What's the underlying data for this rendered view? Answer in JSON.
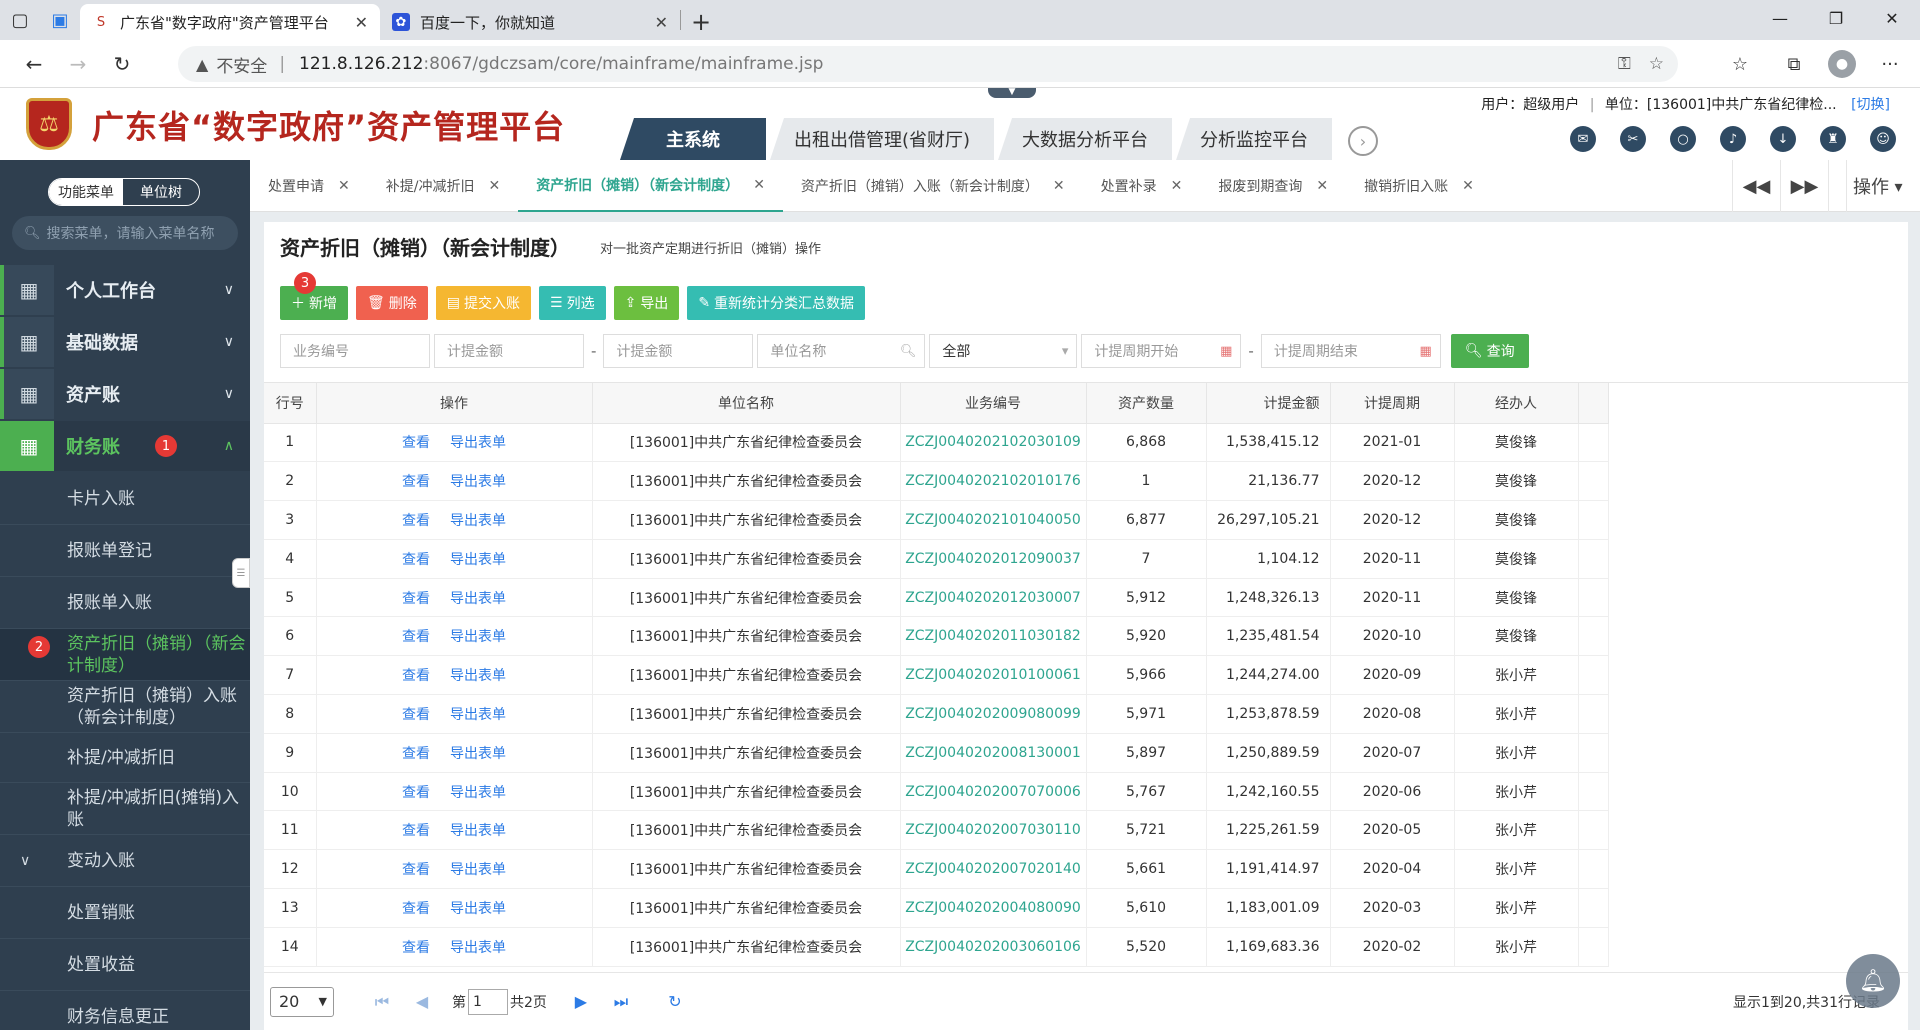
{
  "browser": {
    "tabs": [
      {
        "title": "广东省\"数字政府\"资产管理平台",
        "active": true
      },
      {
        "title": "百度一下，你就知道",
        "active": false
      }
    ],
    "address": {
      "security_label": "不安全",
      "host": "121.8.126.212",
      "path": ":8067/gdczsam/core/mainframe/mainframe.jsp"
    }
  },
  "header": {
    "title": "广东省“数字政府”资产管理平台",
    "user_label": "用户：超级用户",
    "unit_label": "单位：[136001]中共广东省纪律检...",
    "switch_label": "[切换]",
    "system_tabs": [
      "主系统",
      "出租出借管理(省财厅)",
      "大数据分析平台",
      "分析监控平台"
    ]
  },
  "sidebar": {
    "switch": [
      "功能菜单",
      "单位树"
    ],
    "search_placeholder": "搜索菜单，请输入菜单名称",
    "top_menus": [
      "个人工作台",
      "基础数据",
      "资产账",
      "财务账"
    ],
    "sub_items": [
      "卡片入账",
      "报账单登记",
      "报账单入账",
      "资产折旧（摊销）（新会计制度）",
      "资产折旧（摊销）入账（新会计制度）",
      "补提/冲减折旧",
      "补提/冲减折旧(摊销)入账",
      "变动入账",
      "处置销账",
      "处置收益",
      "财务信息更正"
    ],
    "badges": [
      "1",
      "2"
    ]
  },
  "content_tabs": [
    "处置申请",
    "补提/冲减折旧",
    "资产折旧（摊销）（新会计制度）",
    "资产折旧（摊销）入账（新会计制度）",
    "处置补录",
    "报废到期查询",
    "撤销折旧入账"
  ],
  "content_tabs_ops": "操作",
  "page": {
    "title": "资产折旧（摊销）（新会计制度）",
    "description": "对一批资产定期进行折旧（摊销）操作",
    "badge": "3",
    "toolbar": [
      "新增",
      "删除",
      "提交入账",
      "列选",
      "导出",
      "重新统计分类汇总数据"
    ],
    "filters": {
      "biz_no": "业务编号",
      "amount_from": "计提金额",
      "amount_to": "计提金额",
      "unit_name": "单位名称",
      "status_value": "全部",
      "period_start": "计提周期开始",
      "period_end": "计提周期结束",
      "query": "查询"
    }
  },
  "table": {
    "columns": [
      "行号",
      "操作",
      "单位名称",
      "业务编号",
      "资产数量",
      "计提金额",
      "计提周期",
      "经办人"
    ],
    "actions": [
      "查看",
      "导出表单"
    ],
    "rows": [
      [
        "1",
        "[136001]中共广东省纪律检查委员会",
        "ZCZJ0040202102030109",
        "6,868",
        "1,538,415.12",
        "2021-01",
        "莫俊锋"
      ],
      [
        "2",
        "[136001]中共广东省纪律检查委员会",
        "ZCZJ0040202102010176",
        "1",
        "21,136.77",
        "2020-12",
        "莫俊锋"
      ],
      [
        "3",
        "[136001]中共广东省纪律检查委员会",
        "ZCZJ0040202101040050",
        "6,877",
        "26,297,105.21",
        "2020-12",
        "莫俊锋"
      ],
      [
        "4",
        "[136001]中共广东省纪律检查委员会",
        "ZCZJ0040202012090037",
        "7",
        "1,104.12",
        "2020-11",
        "莫俊锋"
      ],
      [
        "5",
        "[136001]中共广东省纪律检查委员会",
        "ZCZJ0040202012030007",
        "5,912",
        "1,248,326.13",
        "2020-11",
        "莫俊锋"
      ],
      [
        "6",
        "[136001]中共广东省纪律检查委员会",
        "ZCZJ0040202011030182",
        "5,920",
        "1,235,481.54",
        "2020-10",
        "莫俊锋"
      ],
      [
        "7",
        "[136001]中共广东省纪律检查委员会",
        "ZCZJ0040202010100061",
        "5,966",
        "1,244,274.00",
        "2020-09",
        "张小芹"
      ],
      [
        "8",
        "[136001]中共广东省纪律检查委员会",
        "ZCZJ0040202009080099",
        "5,971",
        "1,253,878.59",
        "2020-08",
        "张小芹"
      ],
      [
        "9",
        "[136001]中共广东省纪律检查委员会",
        "ZCZJ0040202008130001",
        "5,897",
        "1,250,889.59",
        "2020-07",
        "张小芹"
      ],
      [
        "10",
        "[136001]中共广东省纪律检查委员会",
        "ZCZJ0040202007070006",
        "5,767",
        "1,242,160.55",
        "2020-06",
        "张小芹"
      ],
      [
        "11",
        "[136001]中共广东省纪律检查委员会",
        "ZCZJ0040202007030110",
        "5,721",
        "1,225,261.59",
        "2020-05",
        "张小芹"
      ],
      [
        "12",
        "[136001]中共广东省纪律检查委员会",
        "ZCZJ0040202007020140",
        "5,661",
        "1,191,414.97",
        "2020-04",
        "张小芹"
      ],
      [
        "13",
        "[136001]中共广东省纪律检查委员会",
        "ZCZJ0040202004080090",
        "5,610",
        "1,183,001.09",
        "2020-03",
        "张小芹"
      ],
      [
        "14",
        "[136001]中共广东省纪律检查委员会",
        "ZCZJ0040202003060106",
        "5,520",
        "1,169,683.36",
        "2020-02",
        "张小芹"
      ]
    ]
  },
  "pager": {
    "page_size": "20",
    "page_prefix": "第",
    "page_value": "1",
    "total_pages": "共2页",
    "summary": "显示1到20,共31行记录"
  },
  "colors": {
    "accent": "#4caf50",
    "sidebar": "#2f3f4f",
    "link": "#2c7be5",
    "brand_red": "#b5261e"
  }
}
